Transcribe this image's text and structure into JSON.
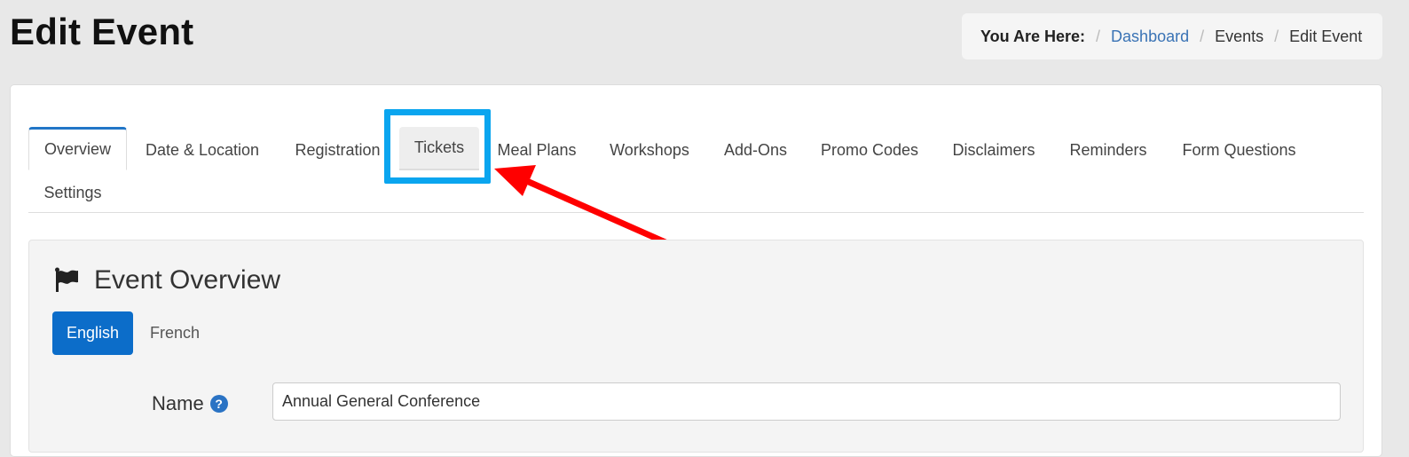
{
  "header": {
    "title": "Edit Event",
    "breadcrumb": {
      "lead": "You Are Here:",
      "items": [
        "Dashboard",
        "Events",
        "Edit Event"
      ]
    }
  },
  "tabs": [
    "Overview",
    "Date & Location",
    "Registration",
    "Tickets",
    "Meal Plans",
    "Workshops",
    "Add-Ons",
    "Promo Codes",
    "Disclaimers",
    "Reminders",
    "Form Questions",
    "Settings"
  ],
  "active_tab": "Overview",
  "highlighted_tab": "Tickets",
  "panel": {
    "heading": "Event Overview",
    "heading_icon": "flag-icon",
    "languages": [
      "English",
      "French"
    ],
    "selected_language": "English"
  },
  "form": {
    "name_label": "Name",
    "name_help_icon": "question-circle-icon",
    "name_value": "Annual General Conference"
  },
  "colors": {
    "accent": "#0c6dc9",
    "highlight": "#0aa5ef",
    "arrow": "#ff0000",
    "link": "#3a73b5"
  }
}
